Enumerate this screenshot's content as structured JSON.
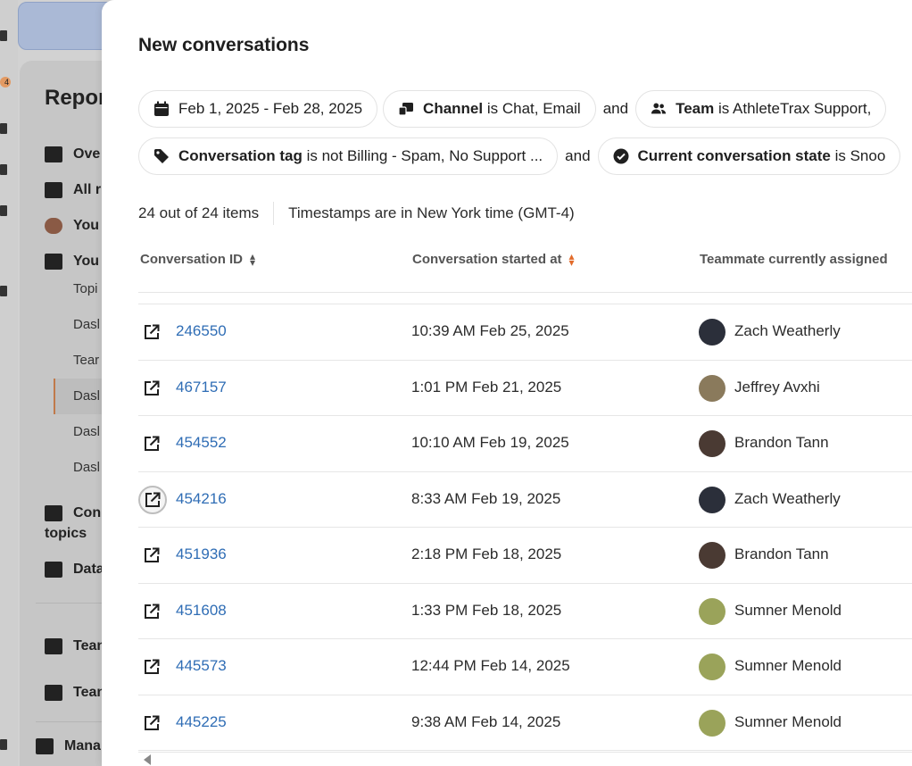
{
  "background": {
    "badge": "4",
    "title": "Repor",
    "items": [
      {
        "label": "Ove"
      },
      {
        "label": "All r"
      },
      {
        "label": "You"
      },
      {
        "label": "You"
      }
    ],
    "subitems": [
      "Topi",
      "Dasl",
      "Tear",
      "Dasl",
      "Dasl",
      "Dasl"
    ],
    "lower_items": [
      "Con",
      "topics",
      "Data",
      "Tean",
      "Tean",
      "Mana"
    ]
  },
  "modal": {
    "title": "New conversations",
    "filters": {
      "date_range": "Feb 1, 2025 - Feb 28, 2025",
      "channel_key": "Channel",
      "channel_value": " is Chat, Email",
      "and1": "and",
      "team_key": "Team",
      "team_value": " is AthleteTrax Support,",
      "tag_key": "Conversation tag",
      "tag_value": " is not Billing - Spam, No Support ...",
      "and2": "and",
      "state_key": "Current conversation state",
      "state_value": " is Snoo"
    },
    "meta": {
      "count": "24 out of 24 items",
      "timezone": "Timestamps are in New York time (GMT-4)"
    },
    "columns": {
      "id": "Conversation ID",
      "started": "Conversation started at",
      "assigned": "Teammate currently assigned"
    },
    "rows": [
      {
        "id": "246550",
        "started": "10:39 AM Feb 25, 2025",
        "assignee": "Zach Weatherly",
        "avatar_color": "#2b2f3a"
      },
      {
        "id": "467157",
        "started": "1:01 PM Feb 21, 2025",
        "assignee": "Jeffrey Avxhi",
        "avatar_color": "#8a7a5c"
      },
      {
        "id": "454552",
        "started": "10:10 AM Feb 19, 2025",
        "assignee": "Brandon Tann",
        "avatar_color": "#4a3a33"
      },
      {
        "id": "454216",
        "started": "8:33 AM Feb 19, 2025",
        "assignee": "Zach Weatherly",
        "avatar_color": "#2b2f3a"
      },
      {
        "id": "451936",
        "started": "2:18 PM Feb 18, 2025",
        "assignee": "Brandon Tann",
        "avatar_color": "#4a3a33"
      },
      {
        "id": "451608",
        "started": "1:33 PM Feb 18, 2025",
        "assignee": "Sumner Menold",
        "avatar_color": "#9aa35a"
      },
      {
        "id": "445573",
        "started": "12:44 PM Feb 14, 2025",
        "assignee": "Sumner Menold",
        "avatar_color": "#9aa35a"
      },
      {
        "id": "445225",
        "started": "9:38 AM Feb 14, 2025",
        "assignee": "Sumner Menold",
        "avatar_color": "#9aa35a"
      }
    ]
  },
  "colors": {
    "link": "#2f6db5",
    "sort_active": "#e26b2b",
    "border": "#e3e3e3"
  }
}
